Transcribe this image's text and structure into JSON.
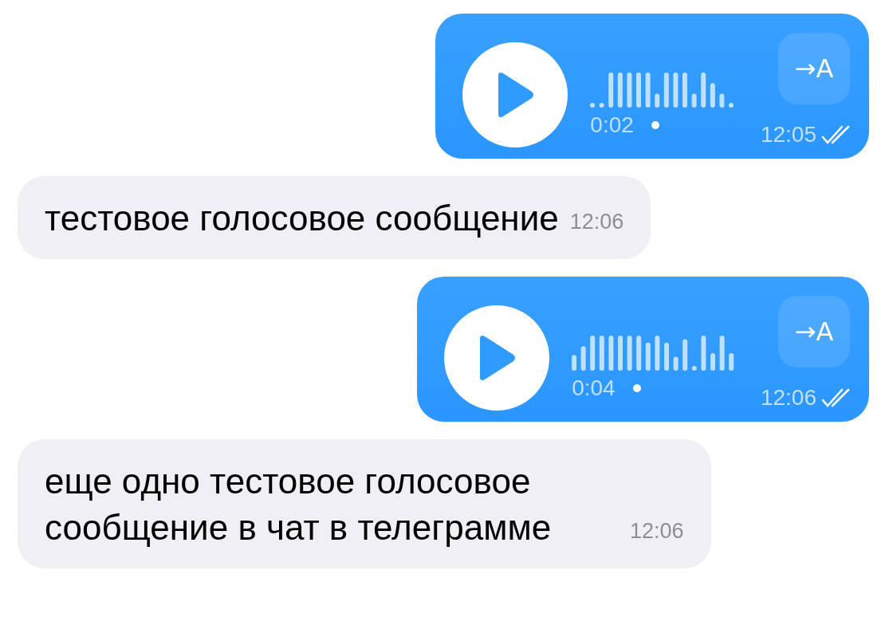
{
  "messages": [
    {
      "kind": "voice",
      "outgoing": true,
      "duration": "0:02",
      "unplayed": true,
      "transcribe_label": "→A",
      "time": "12:05",
      "read": true
    },
    {
      "kind": "text",
      "outgoing": false,
      "text": "тестовое голосовое сообщение",
      "time": "12:06"
    },
    {
      "kind": "voice",
      "outgoing": true,
      "duration": "0:04",
      "unplayed": true,
      "transcribe_label": "→A",
      "time": "12:06",
      "read": true
    },
    {
      "kind": "text",
      "outgoing": false,
      "text": "еще одно тестовое голосовое сообщение в чат в телеграмме",
      "time": "12:06"
    }
  ]
}
